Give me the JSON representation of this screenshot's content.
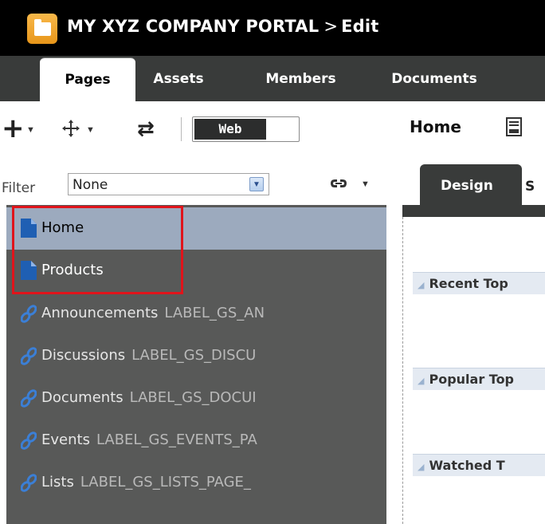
{
  "header": {
    "title": "MY XYZ COMPANY PORTAL",
    "separator": ">",
    "mode": "Edit"
  },
  "tabs": [
    {
      "label": "Pages",
      "active": true
    },
    {
      "label": "Assets",
      "active": false
    },
    {
      "label": "Members",
      "active": false
    },
    {
      "label": "Documents",
      "active": false
    }
  ],
  "toolbar": {
    "add_icon": "plus-icon",
    "move_icon": "move-icon",
    "refresh_icon": "refresh-icon",
    "view_toggle": {
      "selected": "Web"
    },
    "page_name": "Home",
    "page_icon": "page-properties-icon"
  },
  "filter": {
    "label": "Filter",
    "value": "None",
    "link_icon": "link-icon"
  },
  "design_panel": {
    "tab": "Design",
    "next_tab_fragment": "S",
    "regions": [
      "Recent Top",
      "Popular Top",
      "Watched T"
    ]
  },
  "tree": {
    "items": [
      {
        "label": "Home",
        "key": "",
        "icon": "page-icon",
        "selected": true
      },
      {
        "label": "Products",
        "key": "",
        "icon": "page-icon",
        "selected": false
      },
      {
        "label": "Announcements",
        "key": "LABEL_GS_AN",
        "icon": "link-icon",
        "selected": false
      },
      {
        "label": "Discussions",
        "key": "LABEL_GS_DISCU",
        "icon": "link-icon",
        "selected": false
      },
      {
        "label": "Documents",
        "key": "LABEL_GS_DOCUI",
        "icon": "link-icon",
        "selected": false
      },
      {
        "label": "Events",
        "key": "LABEL_GS_EVENTS_PA",
        "icon": "link-icon",
        "selected": false
      },
      {
        "label": "Lists",
        "key": "LABEL_GS_LISTS_PAGE_",
        "icon": "link-icon",
        "selected": false
      }
    ]
  },
  "colors": {
    "titlebar": "#000000",
    "tabsbar": "#393b3a",
    "tree_bg": "#585958",
    "selected_row": "#9caabe",
    "page_icon_blue": "#1f5fb3",
    "highlight_red": "#e0141b"
  }
}
